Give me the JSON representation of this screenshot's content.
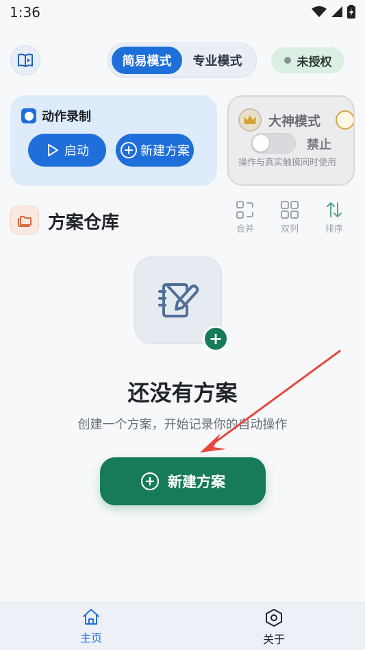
{
  "status_bar": {
    "time": "1:36"
  },
  "top_bar": {
    "book_icon": "book-icon",
    "mode_tabs": [
      "简易模式",
      "专业模式"
    ],
    "active_mode": "简易模式",
    "license_label": "未授权"
  },
  "record_card": {
    "title": "动作录制",
    "start_label": "启动",
    "new_plan_label": "新建方案"
  },
  "god_mode_card": {
    "title": "大神模式",
    "toggle_state": "off",
    "toggle_label": "禁止",
    "description": "操作与真实触摸同时使用"
  },
  "plan_section": {
    "title": "方案仓库",
    "tools": [
      {
        "label": "合并",
        "icon": "merge-icon"
      },
      {
        "label": "双列",
        "icon": "grid-icon"
      },
      {
        "label": "排序",
        "icon": "sort-icon"
      }
    ]
  },
  "empty_state": {
    "title": "还没有方案",
    "subtitle": "创建一个方案，开始记录你的自动操作",
    "button_label": "新建方案"
  },
  "bottom_nav": [
    {
      "label": "主页",
      "icon": "home-icon",
      "active": true
    },
    {
      "label": "关于",
      "icon": "hexagon-icon",
      "active": false
    }
  ],
  "colors": {
    "primary_blue": "#1e6fd9",
    "primary_green": "#177a58",
    "annotation_red": "#e5483f"
  }
}
